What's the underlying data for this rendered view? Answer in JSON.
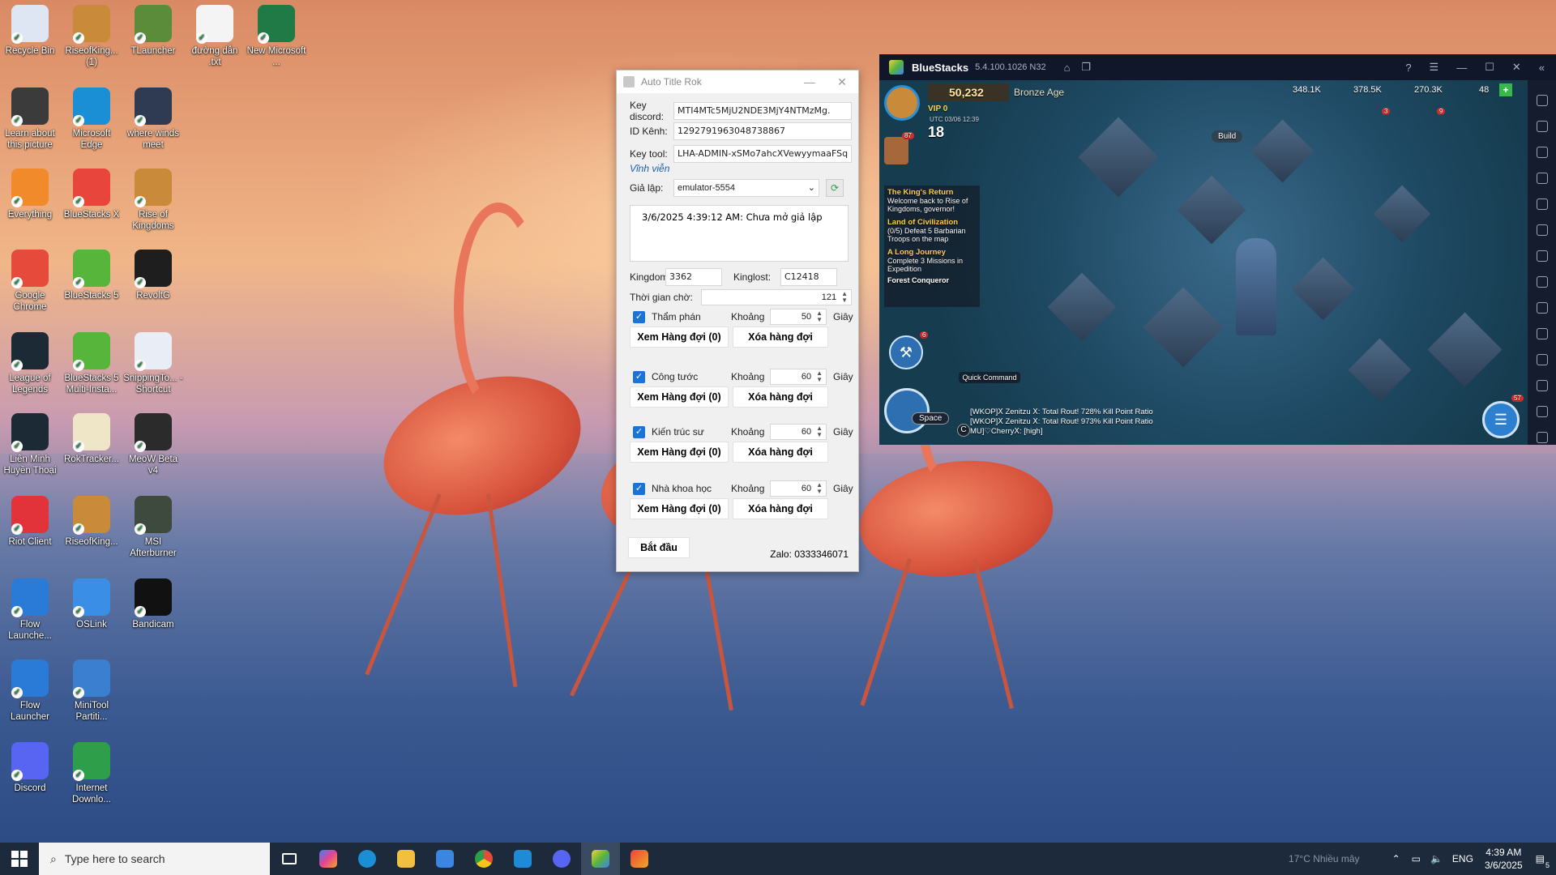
{
  "desktop": {
    "icons": [
      {
        "label": "Recycle Bin",
        "icon": "recycle-bin-icon",
        "color": "#dde6f2"
      },
      {
        "label": "RiseofKing... (1)",
        "icon": "rise-of-kingdoms-icon",
        "color": "#c98a3a"
      },
      {
        "label": "TLauncher",
        "icon": "tlauncher-icon",
        "color": "#5b8c3a"
      },
      {
        "label": "đường dẫn .txt",
        "icon": "text-file-icon",
        "color": "#f4f4f4"
      },
      {
        "label": "New Microsoft ...",
        "icon": "excel-file-icon",
        "color": "#1f7a45"
      },
      {
        "label": "Learn about this picture",
        "icon": "camera-icon",
        "color": "#3b3b3b"
      },
      {
        "label": "Microsoft Edge",
        "icon": "edge-icon",
        "color": "#1b8fd6"
      },
      {
        "label": "where winds meet",
        "icon": "where-winds-meet-icon",
        "color": "#2e3b52"
      },
      {
        "label": "Everything",
        "icon": "search-magnifier-icon",
        "color": "#f08a2a"
      },
      {
        "label": "BlueStacks X",
        "icon": "bluestacks-x-icon",
        "color": "#e8463c"
      },
      {
        "label": "Rise of Kingdoms",
        "icon": "rise-of-kingdoms-icon",
        "color": "#c98a3a"
      },
      {
        "label": "Google Chrome",
        "icon": "chrome-icon",
        "color": "#e64a3a"
      },
      {
        "label": "BlueStacks 5",
        "icon": "bluestacks-icon",
        "color": "#58b53c"
      },
      {
        "label": "RevoltG",
        "icon": "revolt-icon",
        "color": "#1e1e1e"
      },
      {
        "label": "League of Legends",
        "icon": "league-of-legends-icon",
        "color": "#1c2a36"
      },
      {
        "label": "BlueStacks 5 Multi-Insta...",
        "icon": "bluestacks-multi-icon",
        "color": "#58b53c"
      },
      {
        "label": "SnippingTo... - Shortcut",
        "icon": "snipping-tool-icon",
        "color": "#e9eef6"
      },
      {
        "label": "Liên Minh Huyền Thoại",
        "icon": "league-of-legends-icon",
        "color": "#1c2a36"
      },
      {
        "label": "RokTracker...",
        "icon": "archive-file-icon",
        "color": "#efe6c8"
      },
      {
        "label": "MeoW Beta v4",
        "icon": "cat-icon",
        "color": "#2b2b2b"
      },
      {
        "label": "Riot Client",
        "icon": "riot-fist-icon",
        "color": "#e2323a"
      },
      {
        "label": "RiseofKing...",
        "icon": "rise-of-kingdoms-icon",
        "color": "#c98a3a"
      },
      {
        "label": "MSI Afterburner",
        "icon": "msi-afterburner-icon",
        "color": "#3d4a3d"
      },
      {
        "label": "Flow Launche...",
        "icon": "flow-launcher-icon",
        "color": "#2a7ad8"
      },
      {
        "label": "OSLink",
        "icon": "oslink-icon",
        "color": "#3a8ee6"
      },
      {
        "label": "Bandicam",
        "icon": "bandicam-record-icon",
        "color": "#111111"
      },
      {
        "label": "Flow Launcher",
        "icon": "flow-launcher-icon",
        "color": "#2a7ad8"
      },
      {
        "label": "MiniTool Partiti...",
        "icon": "minitool-icon",
        "color": "#3b7fd0"
      },
      {
        "label": "Discord",
        "icon": "discord-icon",
        "color": "#5865f2"
      },
      {
        "label": "Internet Downlo...",
        "icon": "internet-download-manager-icon",
        "color": "#2f9e4a"
      }
    ]
  },
  "tool": {
    "title": "Auto Title Rok",
    "key_discord_label": "Key discord:",
    "key_discord_value": "MTI4MTc5MjU2NDE3MjY4NTMzMg.",
    "id_kenh_label": "ID Kênh:",
    "id_kenh_value": "1292791963048738867",
    "key_tool_label": "Key tool:",
    "key_tool_value": "LHA-ADMIN-xSMo7ahcXVewyymaaFSq",
    "license": "Vĩnh viễn",
    "gia_lap_label": "Giả lập:",
    "gia_lap_value": "emulator-5554",
    "log": "3/6/2025 4:39:12 AM: Chưa mở giả lập",
    "kingdom_label": "Kingdom:",
    "kingdom_value": "3362",
    "kinglost_label": "Kinglost:",
    "kinglost_value": "C12418",
    "wait_label": "Thời gian chờ:",
    "wait_value": "121",
    "interval_label": "Khoảng",
    "unit_label": "Giây",
    "view_queue": "Xem Hàng đợi (0)",
    "clear_queue": "Xóa hàng đợi",
    "titles": [
      {
        "name": "Thẩm phán",
        "interval": "50"
      },
      {
        "name": "Công tước",
        "interval": "60"
      },
      {
        "name": "Kiến trúc sư",
        "interval": "60"
      },
      {
        "name": "Nhà khoa học",
        "interval": "60"
      }
    ],
    "start_button": "Bắt đầu",
    "zalo": "Zalo: 0333346071"
  },
  "bluestacks": {
    "title": "BlueStacks",
    "version": "5.4.100.1026 N32",
    "game": {
      "power": "50,232",
      "age": "Bronze Age",
      "vip": "VIP 0",
      "level": "18",
      "utc": "UTC 03/06 12:39",
      "food": "348.1K",
      "wood": "378.5K",
      "stone": "270.3K",
      "gems": "48",
      "build_label": "Build",
      "quest1_title": "The King's Return",
      "quest1_text": "Welcome back to Rise of Kingdoms, governor!",
      "quest2_title": "Land of Civilization",
      "quest2_text": "(0/5) Defeat 5 Barbarian Troops on the map",
      "quest3_title": "A Long Journey",
      "quest3_text": "Complete 3 Missions in Expedition",
      "quest4_title": "Forest Conqueror",
      "quick_command": "Quick Command",
      "space_key": "Space",
      "c_key": "C",
      "chat1": "[WKOP]Ⅹ Zenitzu Ⅹ: Total Rout! 728% Kill Point Ratio",
      "chat2": "[WKOP]Ⅹ Zenitzu Ⅹ: Total Rout! 973% Kill Point Ratio",
      "chat3": "MU]♡CherryⅩ: [high]",
      "badge_87": "87",
      "badge_6": "6",
      "badge_57": "57",
      "badge_3": "3",
      "badge_9": "9"
    }
  },
  "taskbar": {
    "search_placeholder": "Type here to search",
    "weather": "17°C  Nhiều mây",
    "lang": "ENG",
    "time": "4:39 AM",
    "date": "3/6/2025",
    "notif": "5"
  }
}
